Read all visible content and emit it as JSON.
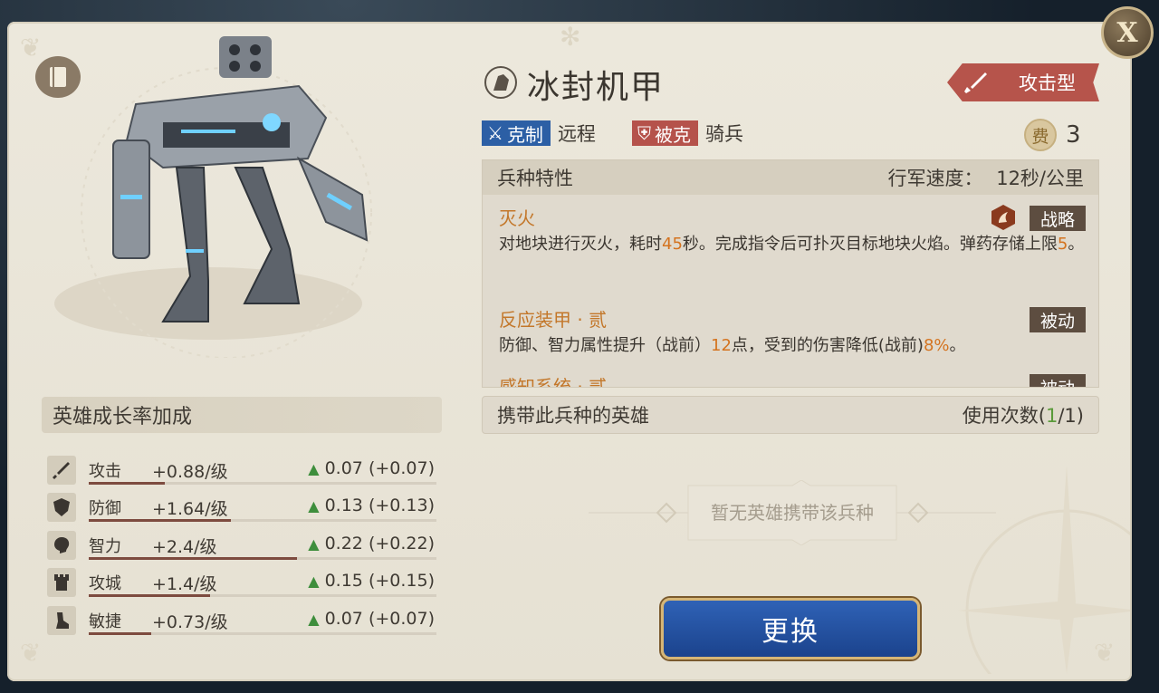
{
  "unit": {
    "name": "冰封机甲",
    "type_label": "攻击型",
    "counter_label": "克制",
    "counter_value": "远程",
    "countered_label": "被克",
    "countered_value": "骑兵",
    "cost_icon": "费",
    "cost_value": "3"
  },
  "traits_panel": {
    "title": "兵种特性",
    "speed_label": "行军速度：",
    "speed_value": "12秒/公里"
  },
  "traits": [
    {
      "name": "灭火",
      "label": "战略",
      "desc_parts": [
        "对地块进行灭火，耗时",
        "45",
        "秒。完成指令后可扑灭目标地块火焰。弹药存储上限",
        "5",
        "。"
      ]
    },
    {
      "name": "反应装甲 · 贰",
      "label": "被动",
      "desc_parts": [
        "防御、智力属性提升（战前）",
        "12",
        "点，受到的伤害降低(战前)",
        "8%",
        "。"
      ]
    },
    {
      "name": "感知系统 · 贰",
      "label": "被动"
    }
  ],
  "heroes": {
    "title": "携带此兵种的英雄",
    "usage_label": "使用次数(",
    "usage_used": "1",
    "usage_total": "/1)",
    "empty_text": "暂无英雄携带该兵种"
  },
  "swap_button": "更换",
  "close_button": "X",
  "growth": {
    "title": "英雄成长率加成",
    "stats": [
      {
        "icon": "sword-icon",
        "name": "攻击",
        "rate": "+0.88/级",
        "gain": "0.07 (+0.07)",
        "bar": 0.22
      },
      {
        "icon": "shield-icon",
        "name": "防御",
        "rate": "+1.64/级",
        "gain": "0.13 (+0.13)",
        "bar": 0.41
      },
      {
        "icon": "brain-icon",
        "name": "智力",
        "rate": "+2.4/级",
        "gain": "0.22 (+0.22)",
        "bar": 0.6
      },
      {
        "icon": "tower-icon",
        "name": "攻城",
        "rate": "+1.4/级",
        "gain": "0.15 (+0.15)",
        "bar": 0.35
      },
      {
        "icon": "boot-icon",
        "name": "敏捷",
        "rate": "+0.73/级",
        "gain": "0.07 (+0.07)",
        "bar": 0.18
      }
    ]
  },
  "colors": {
    "counter_badge": "#2c5fa5",
    "countered_badge": "#b5524b",
    "highlight": "#d4731f",
    "swap_button": "#2a58a8"
  }
}
